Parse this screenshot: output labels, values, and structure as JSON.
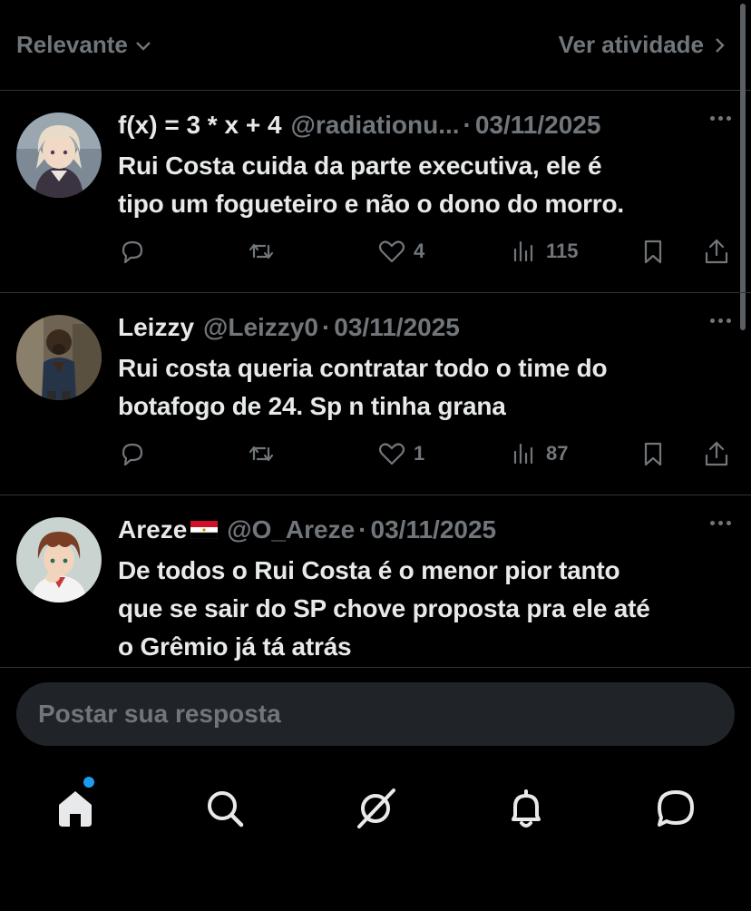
{
  "filter": {
    "sort_label": "Relevante",
    "activity_label": "Ver atividade"
  },
  "replies": [
    {
      "name": "f(x) = 3 * x + 4",
      "handle": "@radiationu...",
      "date": "03/11/2025",
      "text_lines": [
        "Rui Costa cuida da parte executiva, ele é",
        "tipo um fogueteiro e não o dono do morro."
      ],
      "likes": "4",
      "views": "115"
    },
    {
      "name": "Leizzy",
      "handle": "@Leizzy0",
      "date": "03/11/2025",
      "text_lines": [
        "Rui costa queria contratar todo o time do",
        "botafogo de 24. Sp n tinha grana"
      ],
      "likes": "1",
      "views": "87"
    },
    {
      "name": "Areze",
      "handle": "@O_Areze",
      "date": "03/11/2025",
      "text_lines": [
        "De todos o Rui Costa é o menor pior tanto",
        "que se sair do SP chove proposta pra ele até",
        "o Grêmio já tá atrás"
      ]
    }
  ],
  "separator": "·",
  "compose": {
    "placeholder": "Postar sua resposta"
  },
  "nav": {
    "items": [
      "home-icon",
      "search-icon",
      "grok-icon",
      "bell-icon",
      "messages-icon"
    ],
    "home_badge_color": "#1d9bf0"
  },
  "colors": {
    "background": "#000000",
    "text_primary": "#e7e9ea",
    "text_secondary": "#71767b",
    "compose_bg": "#202327"
  }
}
